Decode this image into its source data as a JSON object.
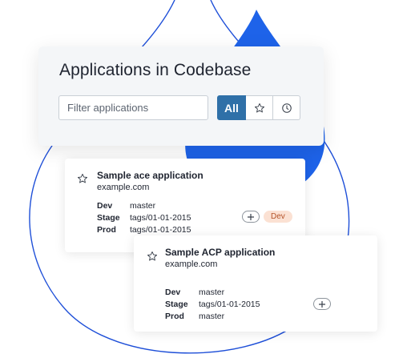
{
  "header": {
    "title": "Applications in Codebase",
    "filter_placeholder": "Filter applications",
    "filter_value": "",
    "filter_all_label": "All",
    "star_filter_icon": "star-outline-icon",
    "recent_filter_icon": "clock-icon"
  },
  "colors": {
    "accent_blue": "#2f70a8",
    "shape_blue": "#1e63e9",
    "badge_bg": "#fbe1d3",
    "badge_text": "#b4532a"
  },
  "applications": [
    {
      "name": "Sample ace application",
      "host": "example.com",
      "environments": [
        {
          "label": "Dev",
          "value": "master"
        },
        {
          "label": "Stage",
          "value": "tags/01-01-2015"
        },
        {
          "label": "Prod",
          "value": "tags/01-01-2015"
        }
      ],
      "badge": "Dev"
    },
    {
      "name": "Sample ACP application",
      "host": "example.com",
      "environments": [
        {
          "label": "Dev",
          "value": "master"
        },
        {
          "label": "Stage",
          "value": "tags/01-01-2015"
        },
        {
          "label": "Prod",
          "value": "master"
        }
      ]
    }
  ]
}
